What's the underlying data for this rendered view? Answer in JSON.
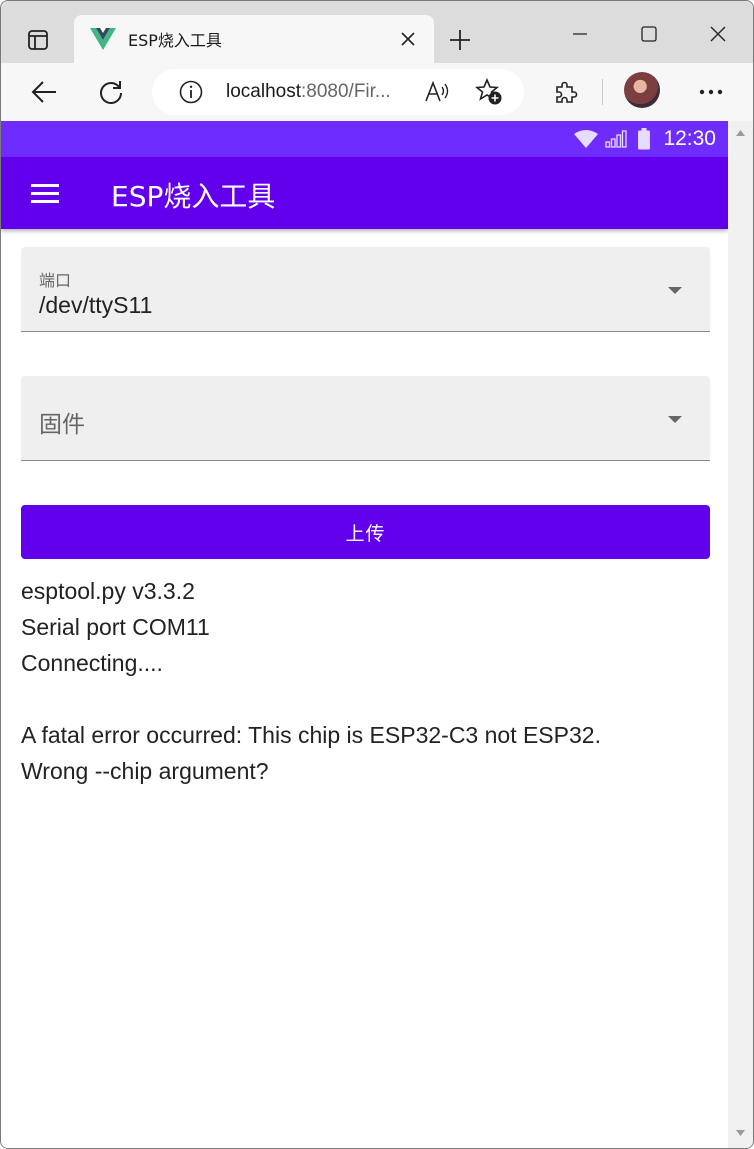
{
  "browser": {
    "tab": {
      "title": "ESP烧入工具"
    },
    "address": {
      "host": "localhost",
      "rest": ":8080/Fir..."
    }
  },
  "statusbar": {
    "time": "12:30"
  },
  "app": {
    "title": "ESP烧入工具",
    "port_field": {
      "label": "端口",
      "value": "/dev/ttyS11"
    },
    "firmware_field": {
      "placeholder": "固件"
    },
    "upload_label": "上传",
    "log_lines": [
      "esptool.py v3.3.2",
      "Serial port COM11",
      "Connecting....",
      "",
      "A fatal error occurred: This chip is ESP32-C3 not ESP32.",
      "Wrong --chip argument?"
    ]
  },
  "colors": {
    "primary": "#6200ee",
    "status_bar": "#6f2cff"
  }
}
